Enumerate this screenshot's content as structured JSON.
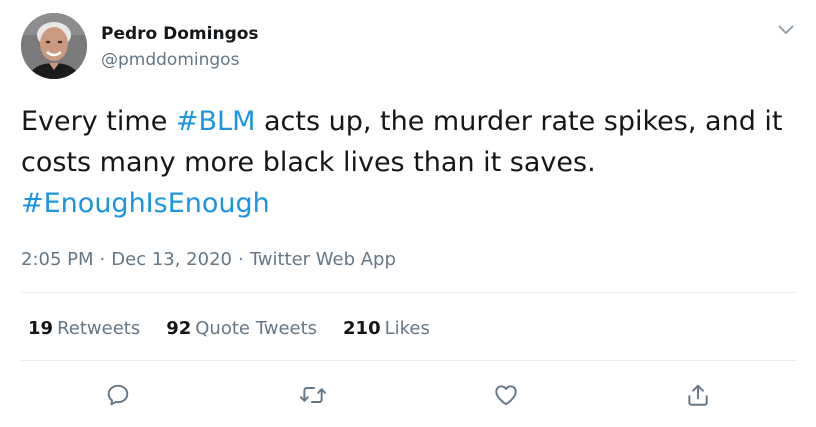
{
  "tweet": {
    "author": {
      "display_name": "Pedro Domingos",
      "handle": "@pmddomingos"
    },
    "text": {
      "part1": "Every time ",
      "hashtag1": "#BLM",
      "part2": " acts up, the murder rate spikes, and it costs many more black lives than it saves. ",
      "hashtag2": "#EnoughIsEnough"
    },
    "time": "2:05 PM",
    "date": "Dec 13, 2020",
    "source": "Twitter Web App",
    "separator": "·",
    "stats": {
      "retweets_count": "19",
      "retweets_label": "Retweets",
      "quote_tweets_count": "92",
      "quote_tweets_label": "Quote Tweets",
      "likes_count": "210",
      "likes_label": "Likes"
    }
  },
  "icons": {
    "caret": "chevron-down-icon",
    "reply": "reply-icon",
    "retweet": "retweet-icon",
    "like": "heart-icon",
    "share": "share-icon"
  },
  "colors": {
    "link": "#1b95e0",
    "icon": "#657786",
    "text": "#14171a",
    "muted": "#657786",
    "divider": "#e6ecf0"
  }
}
